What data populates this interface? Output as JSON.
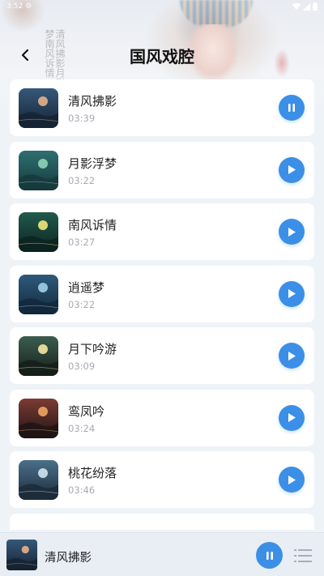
{
  "status_bar": {
    "time": "3:52"
  },
  "header": {
    "title": "国风戏腔",
    "calligraphy": "清风拂影月影浮梦南风诉情"
  },
  "tracks": [
    {
      "title": "清风拂影",
      "duration": "03:39",
      "state": "pause",
      "thumb": [
        "#e6b08a",
        "#36587a",
        "#152332"
      ]
    },
    {
      "title": "月影浮梦",
      "duration": "03:22",
      "state": "play",
      "thumb": [
        "#8fd3b8",
        "#2f6f70",
        "#163a3d"
      ]
    },
    {
      "title": "南风诉情",
      "duration": "03:27",
      "state": "play",
      "thumb": [
        "#f1e77a",
        "#215a4d",
        "#0c2320"
      ]
    },
    {
      "title": "逍遥梦",
      "duration": "03:22",
      "state": "play",
      "thumb": [
        "#9fd0e8",
        "#2e5a7c",
        "#12283c"
      ]
    },
    {
      "title": "月下吟游",
      "duration": "03:09",
      "state": "play",
      "thumb": [
        "#f5e7a0",
        "#3c5d4f",
        "#151f1a"
      ]
    },
    {
      "title": "鸾凤吟",
      "duration": "03:24",
      "state": "play",
      "thumb": [
        "#f0a561",
        "#7c3b34",
        "#1f1414"
      ]
    },
    {
      "title": "桃花纷落",
      "duration": "03:46",
      "state": "play",
      "thumb": [
        "#cfe3f0",
        "#4b6f89",
        "#1b2b3a"
      ]
    }
  ],
  "player": {
    "title": "清风拂影",
    "state": "pause",
    "thumb": [
      "#e6b08a",
      "#36587a",
      "#152332"
    ]
  },
  "colors": {
    "accent": "#3b8fe6",
    "background": "#eef3f8",
    "card": "#ffffff",
    "duration_text": "#a6abb3"
  },
  "icons": {
    "back": "chevron-left-icon",
    "play": "play-icon",
    "pause": "pause-icon",
    "playlist": "playlist-icon"
  }
}
